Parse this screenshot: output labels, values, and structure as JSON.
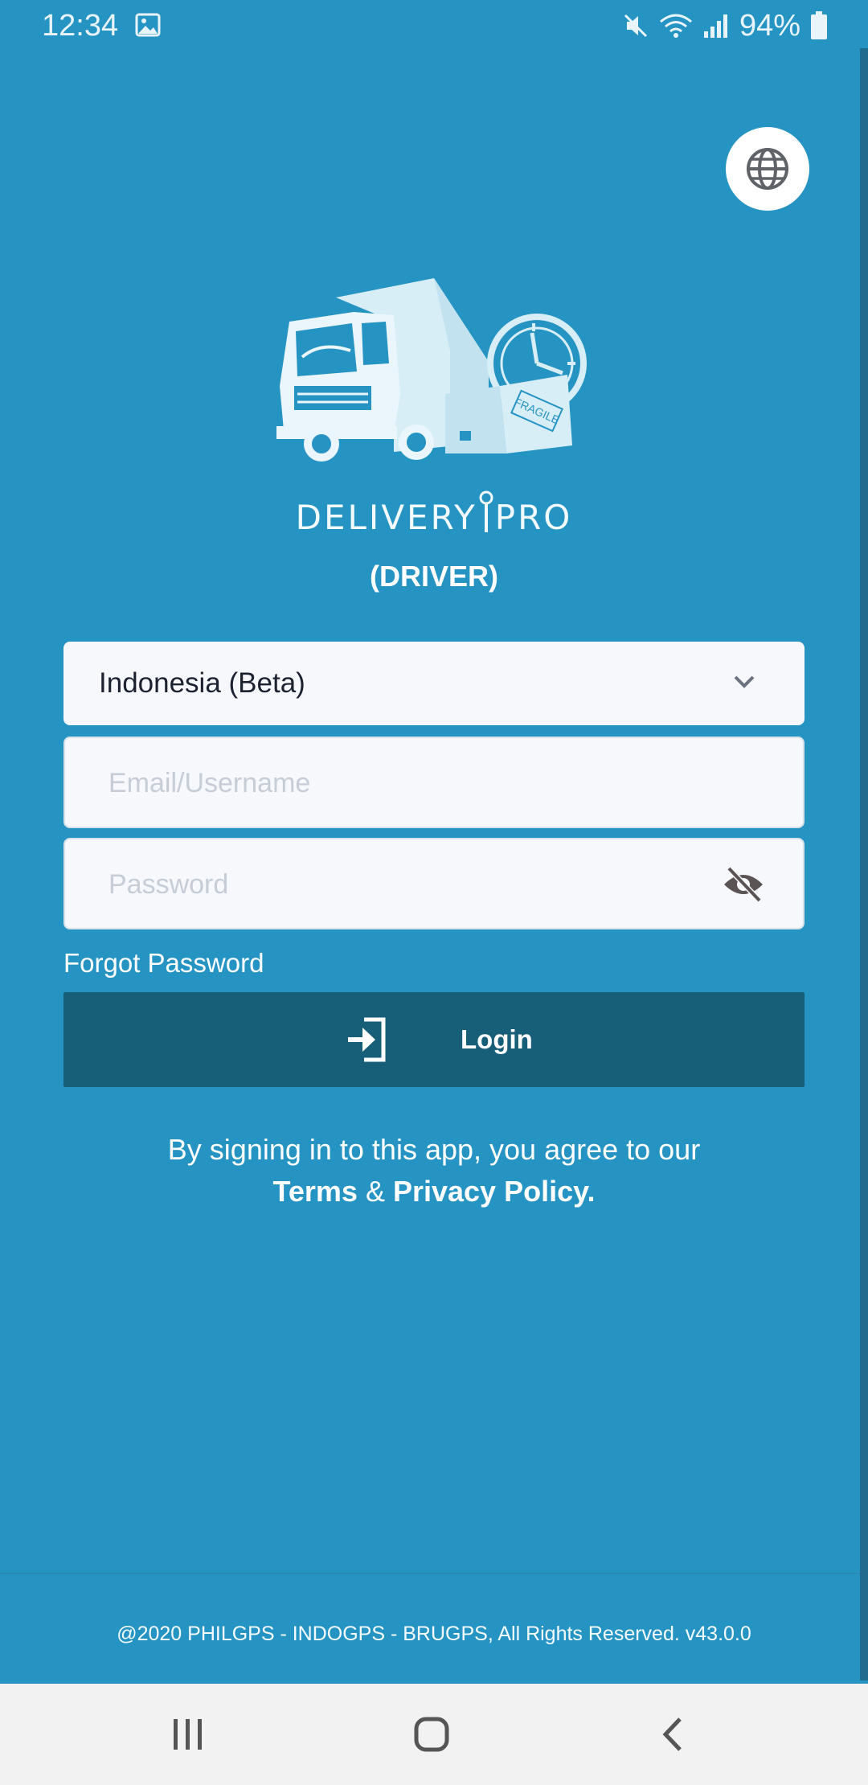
{
  "status_bar": {
    "time": "12:34",
    "battery": "94%",
    "icons": [
      "image-icon",
      "mute-icon",
      "wifi-icon",
      "signal-icon",
      "battery-icon"
    ]
  },
  "logo": {
    "brand_left": "DELIVERY",
    "brand_right": "PRO",
    "role": "(DRIVER)",
    "box_label": "FRAGILE"
  },
  "form": {
    "country_select": "Indonesia (Beta)",
    "email_placeholder": "Email/Username",
    "password_placeholder": "Password",
    "forgot_password": "Forgot Password",
    "login_label": "Login"
  },
  "terms": {
    "line1": "By signing in to this app, you agree to our",
    "terms_link": "Terms",
    "ampersand": " & ",
    "privacy_link": "Privacy Policy."
  },
  "footer": {
    "text": "@2020 PHILGPS - INDOGPS - BRUGPS, All Rights Reserved. v43.0.0"
  },
  "colors": {
    "background": "#2694c3",
    "login_button": "#175e79",
    "field_background": "#f6f8fc"
  }
}
